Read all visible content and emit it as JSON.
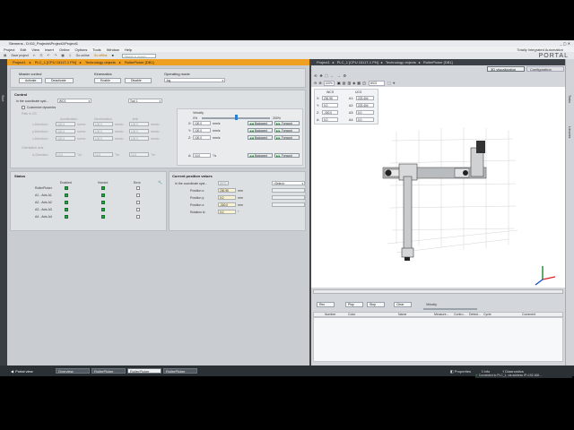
{
  "window": {
    "title": "Siemens - D:\\02_Projects\\Project1\\Project1"
  },
  "menu": {
    "items": [
      "Project",
      "Edit",
      "View",
      "Insert",
      "Online",
      "Options",
      "Tools",
      "Window",
      "Help"
    ],
    "brand": "Totally Integrated Automation"
  },
  "toolbar": {
    "save_label": "Save project",
    "go_online": "Go online",
    "go_offline": "Go offline",
    "search_placeholder": "<Search in project>",
    "portal": "PORTAL"
  },
  "left_strip": {
    "label": "Start"
  },
  "left_crumb": [
    "Project1",
    "PLC_1 [CPU 1511T-1 PN]",
    "Technology objects",
    "RollerPicker [DB1]"
  ],
  "master": {
    "title": "Master control",
    "activate": "Activate",
    "deactivate": "Deactivate"
  },
  "kinematics": {
    "title": "Kinematics",
    "enable": "Enable",
    "disable": "Disable"
  },
  "opmode": {
    "title": "Operating mode",
    "value": "Jog"
  },
  "control": {
    "title": "Control",
    "coord_label": "In the coordinate syst...",
    "coord_value": "WCS",
    "tool_value": "Tool 1",
    "custom_dyn": "Customize dynamics",
    "path_label": "Path in CS",
    "col_accel": "Acceleration",
    "col_decel": "Deceleration",
    "col_jerk": "Jerk",
    "row_labels": [
      "x-Direction:",
      "y-Direction:",
      "z-Direction:",
      "A-Direction:"
    ],
    "orient_label": "Orientation axis",
    "accel_vals": [
      "100.0",
      "100.0",
      "100.0",
      "10.0"
    ],
    "decel_vals": [
      "100.0",
      "100.0",
      "100.0",
      "10.0"
    ],
    "jerk_vals": [
      "100.0",
      "100.0",
      "100.0",
      "10.0"
    ],
    "unit_acc": "mm/s²",
    "unit_jerk": "mm/s³",
    "unit_acc_a": "°/s²",
    "unit_jerk_a": "°/s³",
    "velocity_label": "Velocity",
    "vel_min": "0%",
    "vel_max": "200%",
    "vel_level": 0.5,
    "axes": [
      "X:",
      "Y:",
      "Z:",
      "A:"
    ],
    "vel_vals": [
      "100.0",
      "100.0",
      "100.0",
      "10.0"
    ],
    "vel_units": [
      "mm/s",
      "mm/s",
      "mm/s",
      "°/s"
    ],
    "backward": "Backward",
    "forward": "Forward"
  },
  "status": {
    "title": "Status",
    "col_enabled": "Enabled",
    "col_homed": "Homed",
    "col_error": "Error",
    "obj_label": "RollerPicker",
    "rows": [
      "A1 - Axis A1",
      "A2 - Axis A2",
      "A3 - Axis A3",
      "A4 - Axis A4"
    ]
  },
  "position": {
    "title": "Current position values",
    "coord_label": "In the coordinate syst...",
    "coord_value": "WCS",
    "select_value": "<Select>",
    "labels": [
      "Position x:",
      "Position y:",
      "Position z:",
      "Rotation A:"
    ],
    "values": [
      "230.95",
      "0.0",
      "-300.0",
      "0.0"
    ],
    "units": [
      "mm",
      "mm",
      "mm",
      "°"
    ]
  },
  "right_crumb": [
    "Project1",
    "PLC_1 [CPU 1511T-1 PN]",
    "Technology objects",
    "RollerPicker [DB1]"
  ],
  "right_tabs": [
    "3D visualization",
    "Configuration"
  ],
  "viz": {
    "zoom": "100%",
    "cs_value": "WCS",
    "wcs_head": "WCS",
    "ucs_head": "UCS",
    "wcs_labels": [
      "X:",
      "Y:",
      "Z:",
      "A:"
    ],
    "wcs_vals": [
      "230.95",
      "0.0",
      "-300.0",
      "0.0"
    ],
    "ax_labels": [
      "A1:",
      "A2:",
      "A3:",
      "A4:"
    ],
    "ax_vals": [
      "223.404",
      "223.404",
      "0.0",
      "0.0"
    ]
  },
  "trace": {
    "buttons": [
      "Rec",
      "Play",
      "Stop",
      "Clear"
    ],
    "velocity_label": "Velocity",
    "columns": [
      "Number",
      "Color",
      "Name",
      "Measure...",
      "Contro...",
      "Detect...",
      "Cycle",
      "Comment"
    ]
  },
  "right_strip": [
    "Tasks",
    "Libraries"
  ],
  "statusbar": {
    "portal_view": "Portal view",
    "tabs": [
      "Overview",
      "RollerPicker",
      "RollerPicker",
      "RollerPicker"
    ],
    "properties": "Properties",
    "info": "Info",
    "diagnostics": "Diagnostics",
    "message": "Connected to PLC_1, via address IP=192.168..."
  },
  "colors": {
    "accent_orange": "#f0a020",
    "led_green": "#26a641",
    "taskbar": "#2b3035"
  }
}
